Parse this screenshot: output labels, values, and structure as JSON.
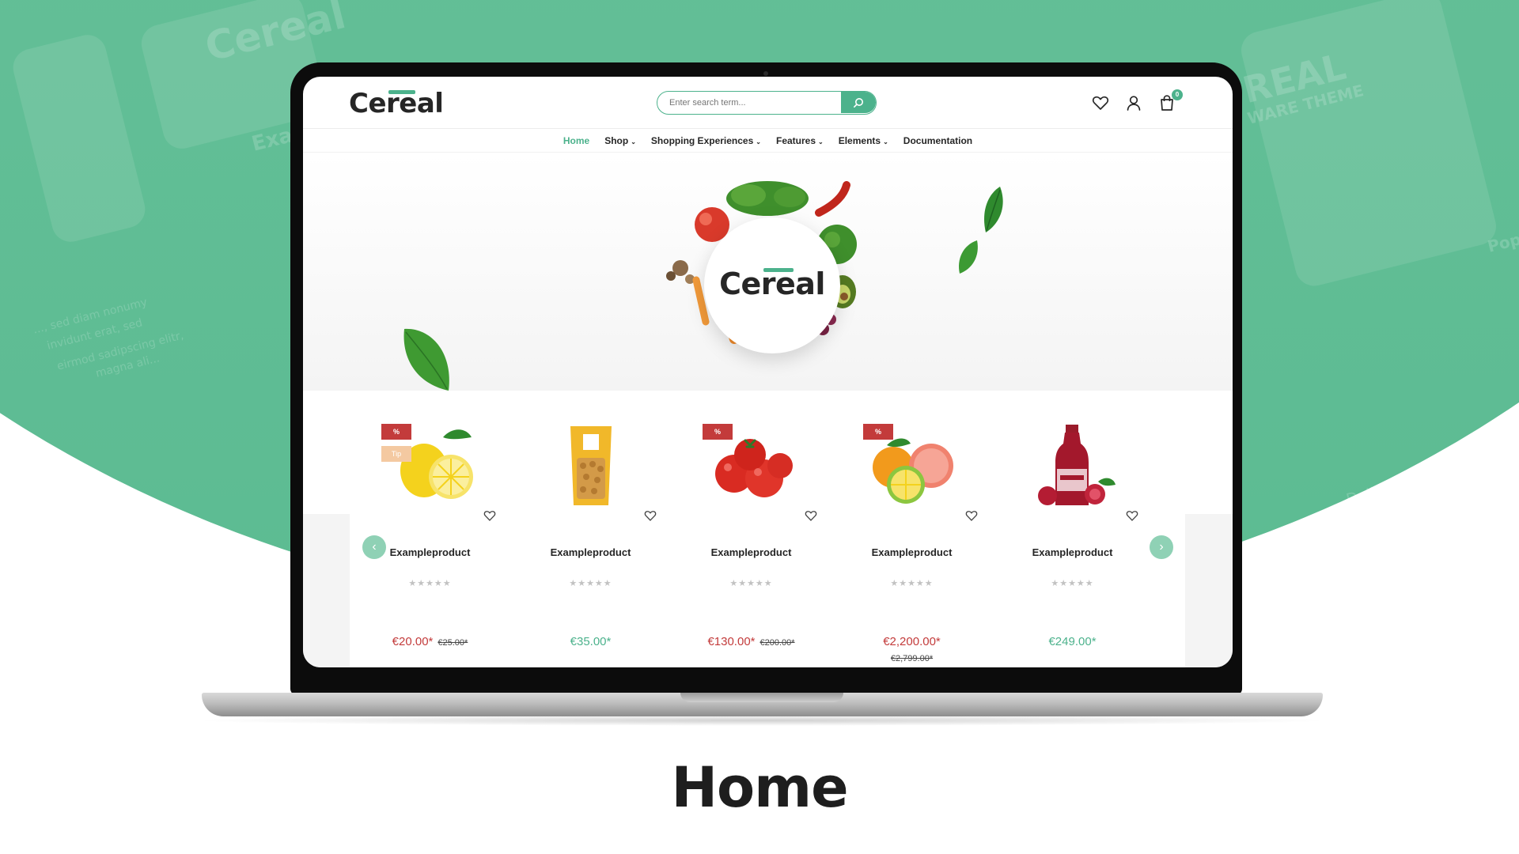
{
  "colors": {
    "accent": "#4cb28c",
    "sale": "#c33b3b",
    "background_green": "#63bf97",
    "tip_badge": "#f4c9a1"
  },
  "background": {
    "ghost_logo": "Cereal",
    "ghost_example": "Exa",
    "ghost_text_1": "..., sed diam nonumy",
    "ghost_text_2": "invidunt erat, sed",
    "ghost_text_3": "eirmod sadipscing elitr,",
    "ghost_text_4": "magna ali...",
    "ghost_theme_1": "REAL",
    "ghost_theme_2": "WARE THEME",
    "ghost_pop": "Pop",
    "ghost_fruit": "Delicious Fruit"
  },
  "header": {
    "logo": "Cereal",
    "search_placeholder": "Enter search term...",
    "search_icon": "search-icon",
    "wishlist_icon": "heart-icon",
    "account_icon": "user-icon",
    "cart_icon": "shopping-bag-icon",
    "cart_count": "0"
  },
  "nav": {
    "items": [
      {
        "label": "Home",
        "active": true,
        "dropdown": false
      },
      {
        "label": "Shop",
        "active": false,
        "dropdown": true
      },
      {
        "label": "Shopping Experiences",
        "active": false,
        "dropdown": true
      },
      {
        "label": "Features",
        "active": false,
        "dropdown": true
      },
      {
        "label": "Elements",
        "active": false,
        "dropdown": true
      },
      {
        "label": "Documentation",
        "active": false,
        "dropdown": false
      }
    ],
    "chevron": "⌄"
  },
  "hero": {
    "logo": "Cereal"
  },
  "products": {
    "items": [
      {
        "name": "Exampleproduct",
        "image": "lemon",
        "badge_discount": "%",
        "badge_tip": "Tip",
        "price": "€20.00*",
        "old_price": "€25.00*",
        "on_sale": true,
        "rating": 0,
        "stars": "★★★★★"
      },
      {
        "name": "Exampleproduct",
        "image": "almonds-bag",
        "badge_discount": "",
        "badge_tip": "",
        "price": "€35.00*",
        "old_price": "",
        "on_sale": false,
        "rating": 0,
        "stars": "★★★★★"
      },
      {
        "name": "Exampleproduct",
        "image": "tomatoes",
        "badge_discount": "%",
        "badge_tip": "",
        "price": "€130.00*",
        "old_price": "€200.00*",
        "on_sale": true,
        "rating": 0,
        "stars": "★★★★★"
      },
      {
        "name": "Exampleproduct",
        "image": "citrus-mix",
        "badge_discount": "%",
        "badge_tip": "",
        "price": "€2,200.00*",
        "old_price": "€2,799.00*",
        "on_sale": true,
        "rating": 0,
        "stars": "★★★★★"
      },
      {
        "name": "Exampleproduct",
        "image": "juice-bottle",
        "badge_discount": "",
        "badge_tip": "",
        "price": "€249.00*",
        "old_price": "",
        "on_sale": false,
        "rating": 0,
        "stars": "★★★★★"
      }
    ],
    "prev_arrow": "‹",
    "next_arrow": "›"
  },
  "caption": "Home"
}
